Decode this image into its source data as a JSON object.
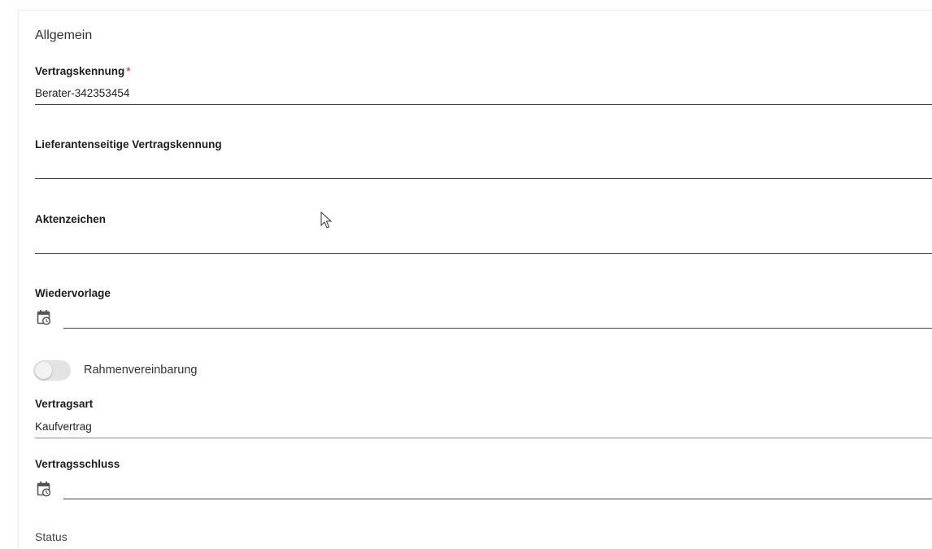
{
  "section": {
    "title": "Allgemein"
  },
  "fields": {
    "vertragskennung": {
      "label": "Vertragskennung",
      "required_marker": "*",
      "value": "Berater-342353454"
    },
    "lieferantenseitige_vertragskennung": {
      "label": "Lieferantenseitige Vertragskennung",
      "value": ""
    },
    "aktenzeichen": {
      "label": "Aktenzeichen",
      "value": ""
    },
    "wiedervorlage": {
      "label": "Wiedervorlage",
      "value": "",
      "icon": "calendar-clock-icon"
    },
    "rahmenvereinbarung": {
      "label": "Rahmenvereinbarung",
      "checked": false
    },
    "vertragsart": {
      "label": "Vertragsart",
      "value": "Kaufvertrag"
    },
    "vertragsschluss": {
      "label": "Vertragsschluss",
      "value": "",
      "icon": "calendar-clock-icon"
    },
    "status": {
      "label": "Status"
    }
  },
  "colors": {
    "required": "#e05a4f",
    "underline": "#444444",
    "toggle_track": "#e3e3e3"
  }
}
